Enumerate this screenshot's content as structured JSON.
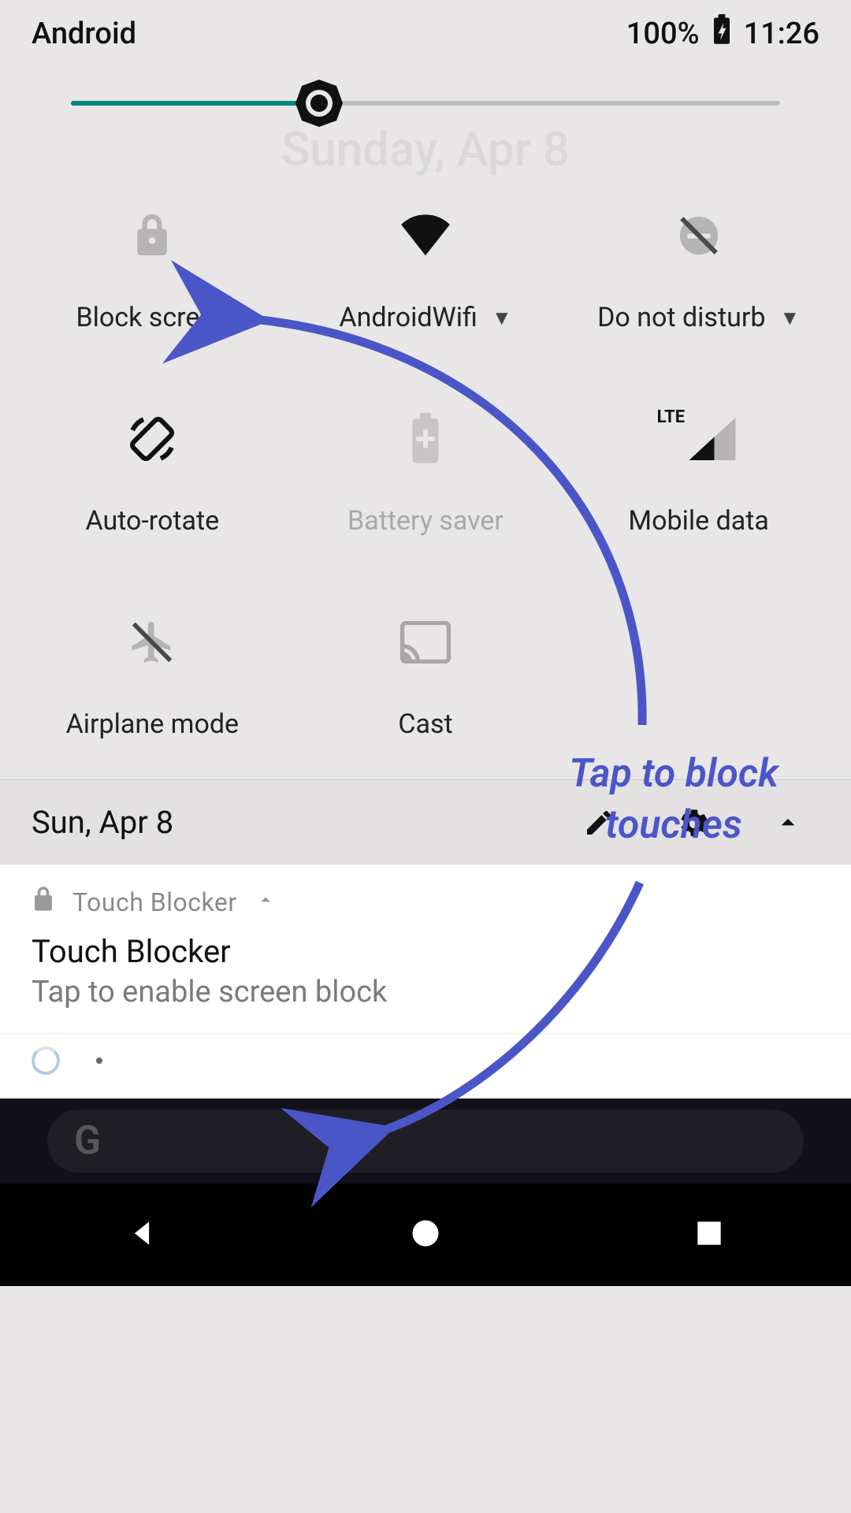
{
  "statusbar": {
    "left_label": "Android",
    "battery_pct": "100%",
    "time": "11:26"
  },
  "brightness": {
    "level_pct": 35
  },
  "background_date": "Sunday, Apr 8",
  "tiles": [
    {
      "id": "block-screen",
      "label": "Block screen",
      "icon": "lock",
      "active": false,
      "dropdown": false,
      "muted_icon": true
    },
    {
      "id": "wifi",
      "label": "AndroidWifi",
      "icon": "wifi",
      "active": true,
      "dropdown": true
    },
    {
      "id": "dnd",
      "label": "Do not disturb",
      "icon": "dnd-off",
      "active": false,
      "dropdown": true,
      "muted_icon": true
    },
    {
      "id": "auto-rotate",
      "label": "Auto-rotate",
      "icon": "rotate",
      "active": true,
      "dropdown": false
    },
    {
      "id": "battery-saver",
      "label": "Battery saver",
      "icon": "battery-plus",
      "active": false,
      "dropdown": false,
      "muted": true
    },
    {
      "id": "mobile-data",
      "label": "Mobile data",
      "icon": "signal-lte",
      "active": true,
      "dropdown": false
    },
    {
      "id": "airplane",
      "label": "Airplane mode",
      "icon": "airplane-off",
      "active": false,
      "dropdown": false,
      "muted_icon": true
    },
    {
      "id": "cast",
      "label": "Cast",
      "icon": "cast",
      "active": false,
      "dropdown": false,
      "muted_icon": true
    }
  ],
  "shade_footer": {
    "date": "Sun, Apr 8"
  },
  "notification": {
    "app_name": "Touch Blocker",
    "title": "Touch Blocker",
    "subtitle": "Tap to enable screen block"
  },
  "annotation": {
    "text_line1": "Tap to block",
    "text_line2": "touches"
  },
  "colors": {
    "accent": "#00897b",
    "annotation": "#4a56c8"
  }
}
